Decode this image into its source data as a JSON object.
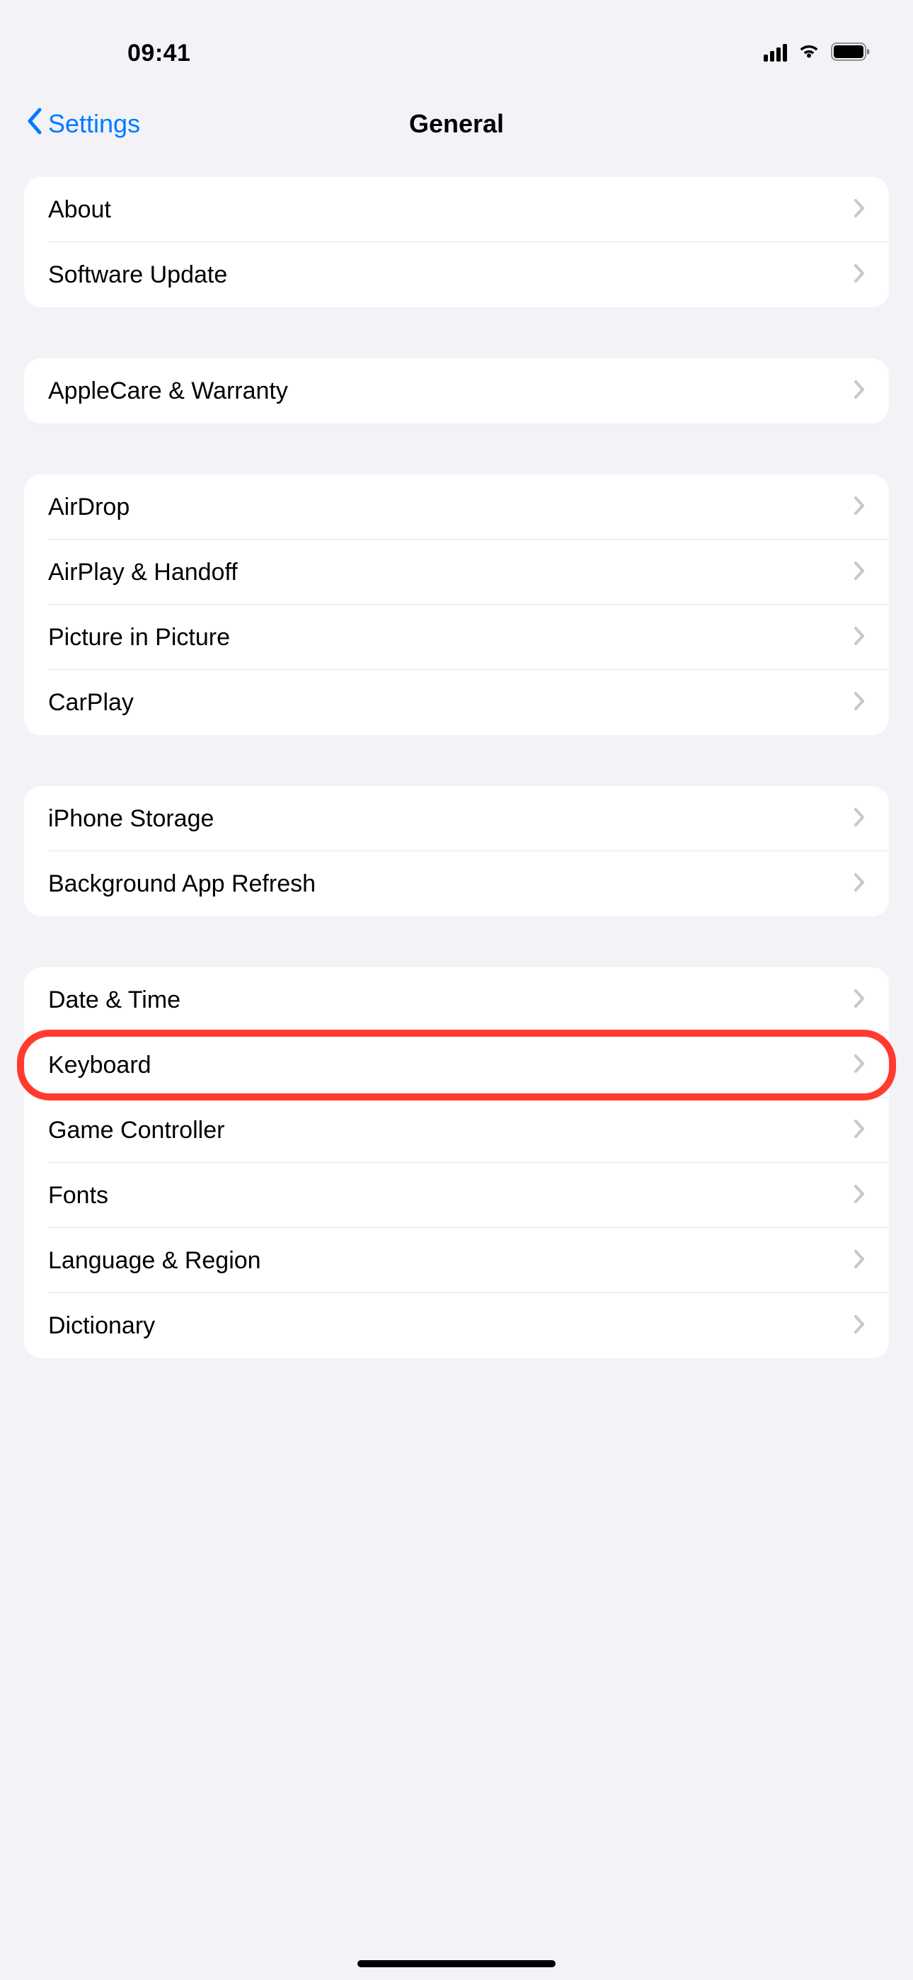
{
  "status": {
    "time": "09:41"
  },
  "nav": {
    "back_label": "Settings",
    "title": "General"
  },
  "groups": [
    {
      "items": [
        {
          "key": "about",
          "label": "About"
        },
        {
          "key": "software-update",
          "label": "Software Update"
        }
      ]
    },
    {
      "items": [
        {
          "key": "applecare-warranty",
          "label": "AppleCare & Warranty"
        }
      ]
    },
    {
      "items": [
        {
          "key": "airdrop",
          "label": "AirDrop"
        },
        {
          "key": "airplay-handoff",
          "label": "AirPlay & Handoff"
        },
        {
          "key": "picture-in-picture",
          "label": "Picture in Picture"
        },
        {
          "key": "carplay",
          "label": "CarPlay"
        }
      ]
    },
    {
      "items": [
        {
          "key": "iphone-storage",
          "label": "iPhone Storage"
        },
        {
          "key": "background-app-refresh",
          "label": "Background App Refresh"
        }
      ]
    },
    {
      "items": [
        {
          "key": "date-time",
          "label": "Date & Time"
        },
        {
          "key": "keyboard",
          "label": "Keyboard",
          "highlighted": true
        },
        {
          "key": "game-controller",
          "label": "Game Controller"
        },
        {
          "key": "fonts",
          "label": "Fonts"
        },
        {
          "key": "language-region",
          "label": "Language & Region"
        },
        {
          "key": "dictionary",
          "label": "Dictionary"
        }
      ]
    }
  ]
}
